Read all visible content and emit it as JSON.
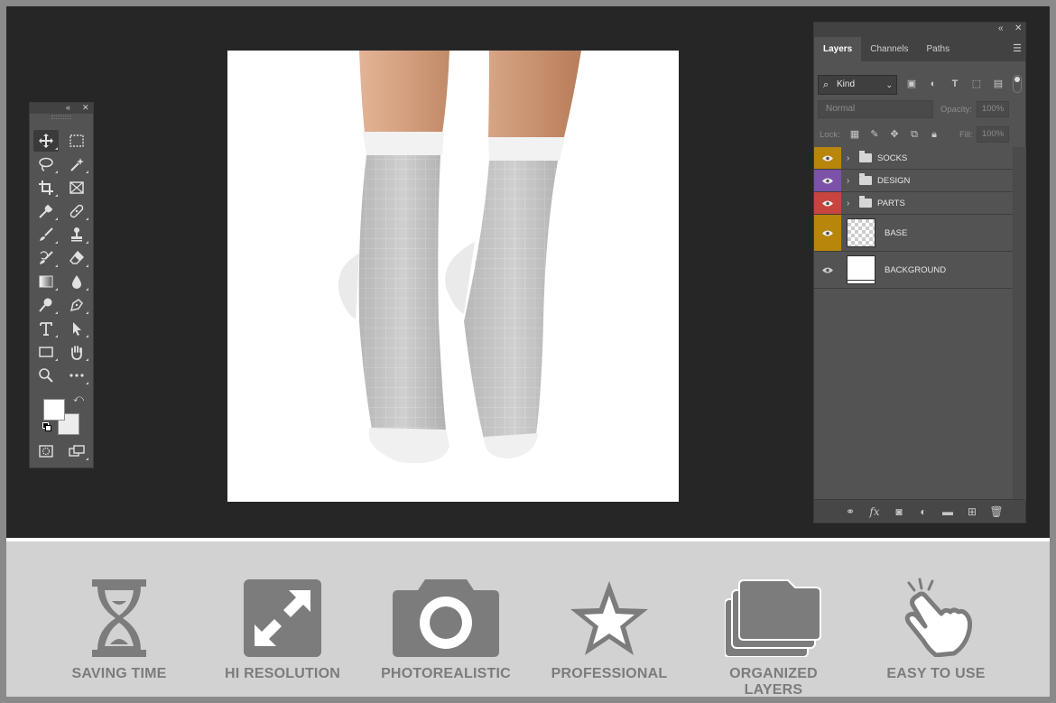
{
  "layers_panel": {
    "tabs": [
      {
        "label": "Layers",
        "active": true
      },
      {
        "label": "Channels",
        "active": false
      },
      {
        "label": "Paths",
        "active": false
      }
    ],
    "filter_kind": "Kind",
    "blend_mode": "Normal",
    "opacity_label": "Opacity:",
    "opacity_value": "100%",
    "lock_label": "Lock:",
    "fill_label": "Fill:",
    "fill_value": "100%",
    "layers": [
      {
        "name": "SOCKS",
        "type": "group",
        "tag_color": "#b8860b"
      },
      {
        "name": "DESIGN",
        "type": "group",
        "tag_color": "#7b52a8"
      },
      {
        "name": "PARTS",
        "type": "group",
        "tag_color": "#c8443f"
      },
      {
        "name": "BASE",
        "type": "layer",
        "tag_color": "#b8860b"
      },
      {
        "name": "BACKGROUND",
        "type": "layer",
        "tag_color": "#535353"
      }
    ]
  },
  "tools_panel": {
    "tools": [
      "move-tool",
      "marquee-tool",
      "lasso-tool",
      "magic-wand-tool",
      "crop-tool",
      "frame-tool",
      "eyedropper-tool",
      "healing-brush-tool",
      "brush-tool",
      "clone-stamp-tool",
      "history-brush-tool",
      "eraser-tool",
      "gradient-tool",
      "blur-tool",
      "dodge-tool",
      "pen-tool",
      "type-tool",
      "path-selection-tool",
      "rectangle-tool",
      "hand-tool",
      "zoom-tool",
      "more-tools",
      "quick-mask",
      "screen-mode"
    ],
    "foreground_color": "#ffffff",
    "background_color": "#ececec"
  },
  "features": [
    {
      "label": "SAVING TIME",
      "icon": "hourglass-icon"
    },
    {
      "label": "HI RESOLUTION",
      "icon": "expand-arrows-icon"
    },
    {
      "label": "PHOTOREALISTIC",
      "icon": "camera-icon"
    },
    {
      "label": "PROFESSIONAL",
      "icon": "star-icon"
    },
    {
      "label": "ORGANIZED LAYERS",
      "icon": "folders-icon"
    },
    {
      "label": "EASY TO USE",
      "icon": "pointing-hand-icon"
    }
  ],
  "colors": {
    "workspace": "#262626",
    "panel": "#535353",
    "banner": "#d2d2d2",
    "banner_icon": "#7c7c7c"
  }
}
